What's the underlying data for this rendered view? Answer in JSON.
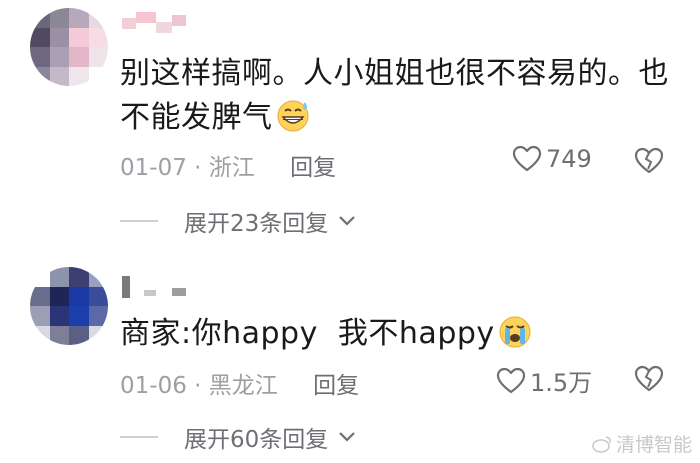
{
  "comments": [
    {
      "text_line1": "别这样搞啊。人小姐姐也很不容易的。也",
      "text_line2": "不能发脾气",
      "emoji": "grinning-sweat-emoji",
      "date": "01-07",
      "separator": "·",
      "location": "浙江",
      "reply_label": "回复",
      "like_count": "749",
      "expand_label": "展开23条回复"
    },
    {
      "text_line1": "商家:你happy  我不happy",
      "emoji": "loudly-crying-emoji",
      "date": "01-06",
      "separator": "·",
      "location": "黑龙江",
      "reply_label": "回复",
      "like_count": "1.5万",
      "expand_label": "展开60条回复"
    }
  ],
  "watermark": {
    "text": "清博智能"
  },
  "colors": {
    "meta": "#9e9ea4",
    "text": "#1a1a1a",
    "icon": "#6e6e75"
  }
}
